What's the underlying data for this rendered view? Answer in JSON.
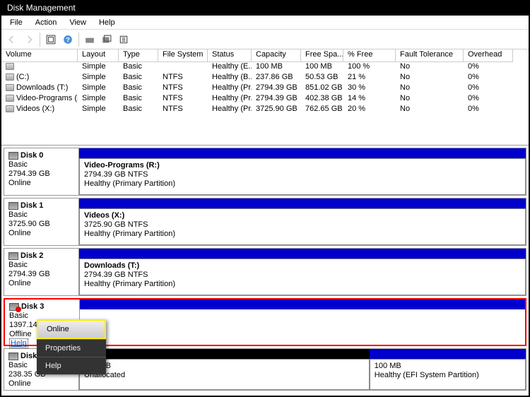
{
  "window": {
    "title": "Disk Management"
  },
  "menu": {
    "file": "File",
    "action": "Action",
    "view": "View",
    "help": "Help"
  },
  "columns": {
    "volume": "Volume",
    "layout": "Layout",
    "type": "Type",
    "fs": "File System",
    "status": "Status",
    "capacity": "Capacity",
    "free": "Free Spa...",
    "pfree": "% Free",
    "fault": "Fault Tolerance",
    "overhead": "Overhead"
  },
  "volumes": [
    {
      "name": "",
      "layout": "Simple",
      "type": "Basic",
      "fs": "",
      "status": "Healthy (E...",
      "cap": "100 MB",
      "free": "100 MB",
      "pfree": "100 %",
      "fault": "No",
      "ov": "0%"
    },
    {
      "name": "(C:)",
      "layout": "Simple",
      "type": "Basic",
      "fs": "NTFS",
      "status": "Healthy (B...",
      "cap": "237.86 GB",
      "free": "50.53 GB",
      "pfree": "21 %",
      "fault": "No",
      "ov": "0%"
    },
    {
      "name": "Downloads (T:)",
      "layout": "Simple",
      "type": "Basic",
      "fs": "NTFS",
      "status": "Healthy (Pr...",
      "cap": "2794.39 GB",
      "free": "851.02 GB",
      "pfree": "30 %",
      "fault": "No",
      "ov": "0%"
    },
    {
      "name": "Video-Programs (R:)",
      "layout": "Simple",
      "type": "Basic",
      "fs": "NTFS",
      "status": "Healthy (Pr...",
      "cap": "2794.39 GB",
      "free": "402.38 GB",
      "pfree": "14 %",
      "fault": "No",
      "ov": "0%"
    },
    {
      "name": "Videos (X:)",
      "layout": "Simple",
      "type": "Basic",
      "fs": "NTFS",
      "status": "Healthy (Pr...",
      "cap": "3725.90 GB",
      "free": "762.65 GB",
      "pfree": "20 %",
      "fault": "No",
      "ov": "0%"
    }
  ],
  "disks": [
    {
      "name": "Disk 0",
      "type": "Basic",
      "size": "2794.39 GB",
      "status": "Online",
      "part": {
        "title": "Video-Programs  (R:)",
        "sub": "2794.39 GB NTFS",
        "health": "Healthy (Primary Partition)"
      }
    },
    {
      "name": "Disk 1",
      "type": "Basic",
      "size": "3725.90 GB",
      "status": "Online",
      "part": {
        "title": "Videos  (X:)",
        "sub": "3725.90 GB NTFS",
        "health": "Healthy (Primary Partition)"
      }
    },
    {
      "name": "Disk 2",
      "type": "Basic",
      "size": "2794.39 GB",
      "status": "Online",
      "part": {
        "title": "Downloads  (T:)",
        "sub": "2794.39 GB NTFS",
        "health": "Healthy (Primary Partition)"
      }
    },
    {
      "name": "Disk 3",
      "type": "Basic",
      "size": "1397.14",
      "status": "Offline",
      "help": "Help"
    },
    {
      "name": "Disk",
      "type": "Basic",
      "size": "238.35 GB",
      "status": "Online",
      "p1": {
        "sub": "401 MB",
        "health": "Unallocated"
      },
      "p2": {
        "sub": "100 MB",
        "health": "Healthy (EFI System Partition)"
      }
    }
  ],
  "context": {
    "online": "Online",
    "properties": "Properties",
    "help": "Help"
  }
}
